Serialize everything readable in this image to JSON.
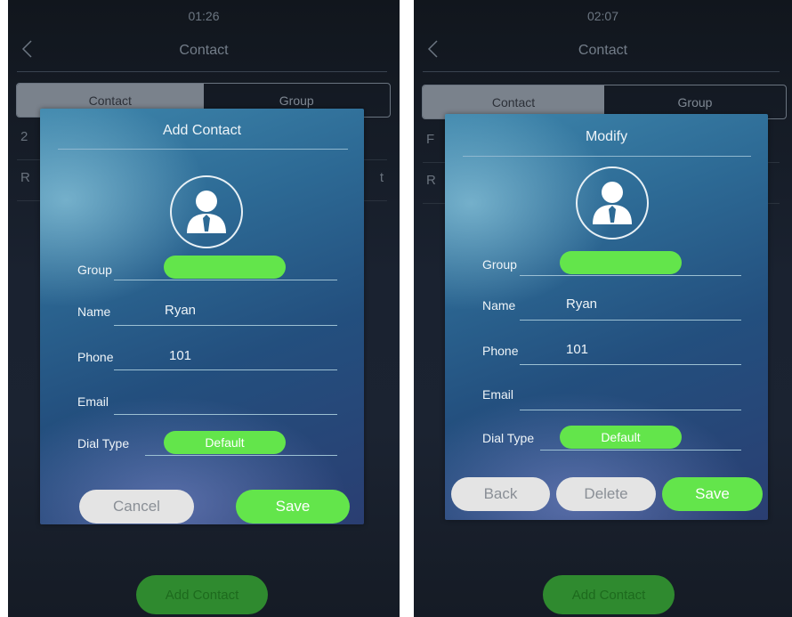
{
  "left": {
    "time": "01:26",
    "header_title": "Contact",
    "tabs": [
      "Contact",
      "Group"
    ],
    "rows": [
      {
        "left": "2",
        "right": ""
      },
      {
        "left": "R",
        "right": "t"
      }
    ],
    "add_contact_label": "Add Contact",
    "dialog": {
      "title": "Add Contact",
      "fields": {
        "group_label": "Group",
        "group_value": "",
        "name_label": "Name",
        "name_value": "Ryan",
        "phone_label": "Phone",
        "phone_value": "101",
        "email_label": "Email",
        "email_value": "",
        "dial_type_label": "Dial Type",
        "dial_type_value": "Default"
      },
      "buttons": {
        "cancel": "Cancel",
        "save": "Save"
      }
    }
  },
  "right": {
    "time": "02:07",
    "header_title": "Contact",
    "tabs": [
      "Contact",
      "Group"
    ],
    "rows": [
      {
        "left": "F",
        "right": ""
      },
      {
        "left": "R",
        "right": ""
      }
    ],
    "add_contact_label": "Add Contact",
    "dialog": {
      "title": "Modify",
      "fields": {
        "group_label": "Group",
        "group_value": "",
        "name_label": "Name",
        "name_value": "Ryan",
        "phone_label": "Phone",
        "phone_value": "101",
        "email_label": "Email",
        "email_value": "",
        "dial_type_label": "Dial Type",
        "dial_type_value": "Default"
      },
      "buttons": {
        "back": "Back",
        "delete": "Delete",
        "save": "Save"
      }
    }
  },
  "colors": {
    "accent_green": "#63e54b",
    "dialog_blue": "#2d6a95",
    "screen_bg": "#1a2230"
  }
}
